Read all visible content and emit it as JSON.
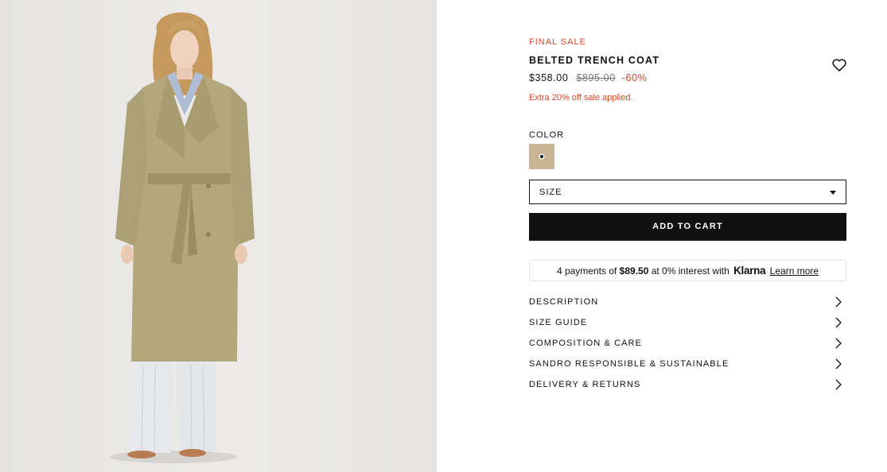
{
  "product_image": {
    "alt": "Model wearing belted trench coat"
  },
  "product": {
    "badge": "FINAL SALE",
    "title": "BELTED TRENCH COAT",
    "price": "$358.00",
    "original_price": "$895.00",
    "discount": "-60%",
    "promo_note": "Extra 20% off sale applied."
  },
  "wishlist": {
    "icon": "heart-icon"
  },
  "color": {
    "label": "COLOR",
    "swatch_hex": "#c9b593"
  },
  "size": {
    "label": "SIZE",
    "icon": "caret-down-icon"
  },
  "cart": {
    "add_label": "ADD TO CART"
  },
  "klarna": {
    "prefix": "4 payments of",
    "amount": "$89.50",
    "middle": "at 0% interest with",
    "brand": "Klarna",
    "learn_more": "Learn more"
  },
  "accordion": [
    {
      "label": "DESCRIPTION"
    },
    {
      "label": "SIZE GUIDE"
    },
    {
      "label": "COMPOSITION & CARE"
    },
    {
      "label": "SANDRO RESPONSIBLE & SUSTAINABLE"
    },
    {
      "label": "DELIVERY & RETURNS"
    }
  ],
  "colors": {
    "accent_red": "#d9482b",
    "black": "#111111",
    "coat": "#b3a87c"
  }
}
